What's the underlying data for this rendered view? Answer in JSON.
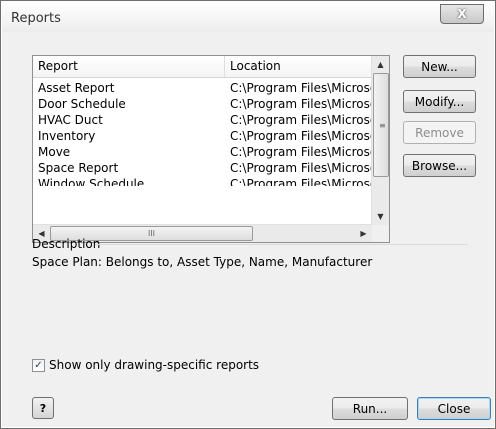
{
  "window": {
    "title": "Reports",
    "close_label": "X"
  },
  "list": {
    "columns": [
      "Report",
      "Location"
    ],
    "rows": [
      {
        "report": "Asset Report",
        "location": "C:\\Program Files\\Microsof"
      },
      {
        "report": "Door Schedule",
        "location": "C:\\Program Files\\Microsof"
      },
      {
        "report": "HVAC Duct",
        "location": "C:\\Program Files\\Microsof"
      },
      {
        "report": "Inventory",
        "location": "C:\\Program Files\\Microsof"
      },
      {
        "report": "Move",
        "location": "C:\\Program Files\\Microsof"
      },
      {
        "report": "Space Report",
        "location": "C:\\Program Files\\Microsof"
      },
      {
        "report": "Window Schedule",
        "location": "C:\\Program Files\\Microsof"
      }
    ]
  },
  "buttons": {
    "new": "New...",
    "modify": "Modify...",
    "remove": "Remove",
    "browse": "Browse...",
    "run": "Run...",
    "close": "Close",
    "help": "?"
  },
  "description": {
    "label": "Description",
    "text": "Space Plan: Belongs to, Asset Type, Name,  Manufacturer"
  },
  "checkbox": {
    "label": "Show only drawing-specific reports",
    "checked": true
  },
  "icons": {
    "scroll_up": "▲",
    "scroll_down": "▼",
    "scroll_left": "◀",
    "scroll_right": "▶",
    "grip_v": "≡",
    "grip_h": "III",
    "check": "✓"
  }
}
